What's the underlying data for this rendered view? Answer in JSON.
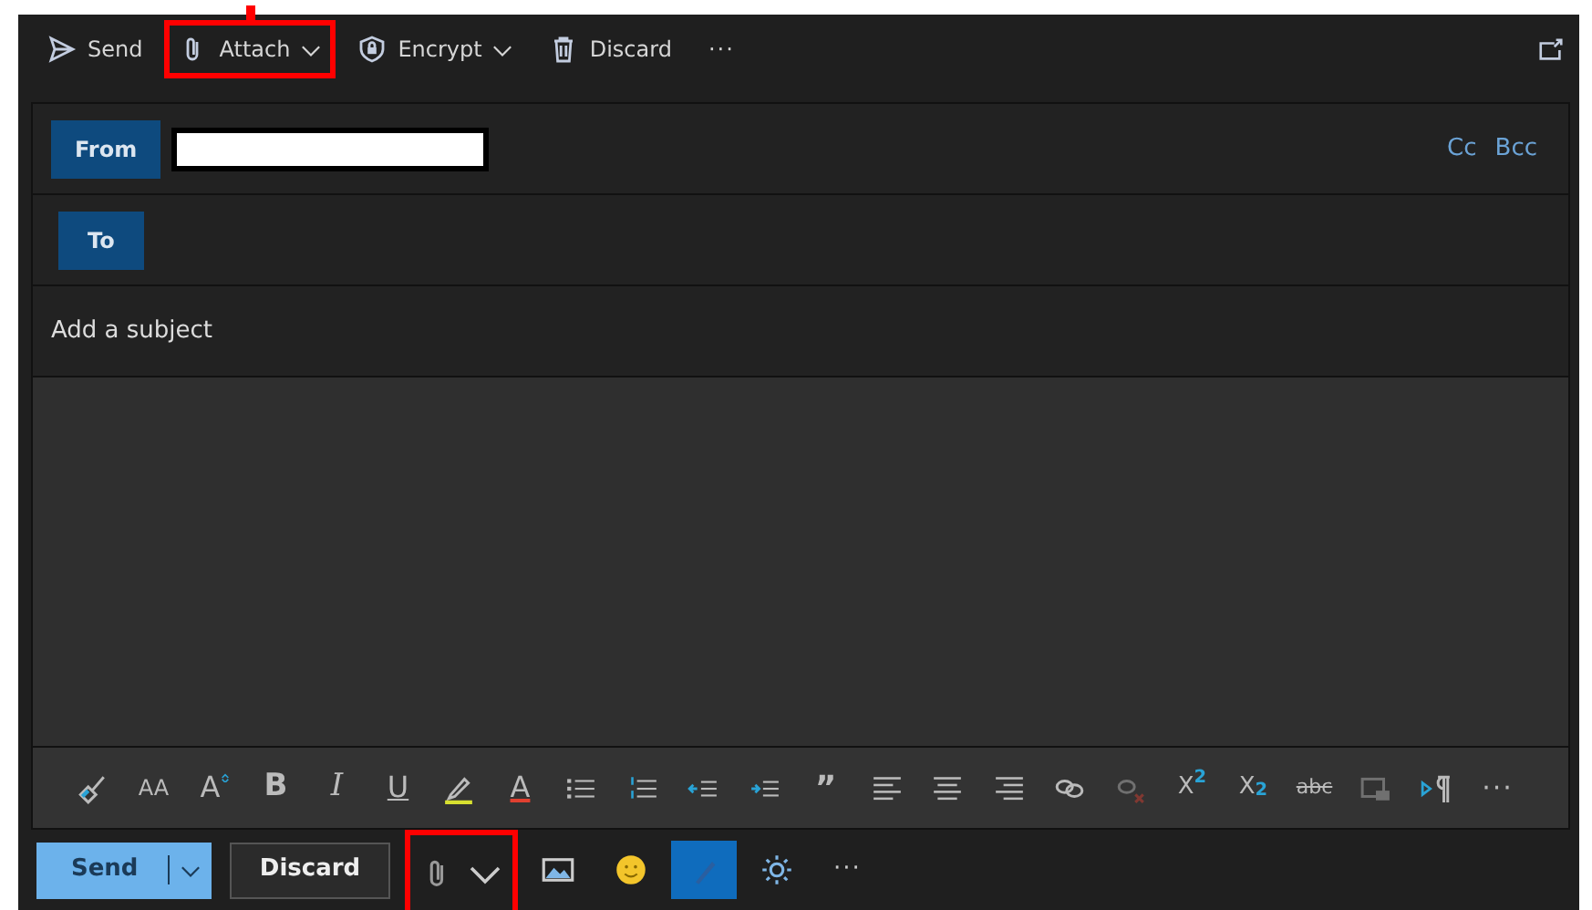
{
  "toolbar": {
    "items": [
      {
        "kind": "send",
        "label": "Send",
        "dropdown": false,
        "highlighted": false
      },
      {
        "kind": "attach",
        "label": "Attach",
        "dropdown": true,
        "highlighted": true
      },
      {
        "kind": "encrypt",
        "label": "Encrypt",
        "dropdown": true,
        "highlighted": false
      },
      {
        "kind": "discard",
        "label": "Discard",
        "dropdown": false,
        "highlighted": false
      },
      {
        "kind": "more",
        "label": "···",
        "highlighted": false
      }
    ]
  },
  "header": {
    "from": {
      "label": "From"
    },
    "to": {
      "label": "To"
    },
    "cc": "Cc",
    "bcc": "Bcc",
    "subject": {
      "placeholder": "Add a subject"
    }
  },
  "format_tools": [
    {
      "kind": "brush",
      "disabled": false
    },
    {
      "kind": "fontsize",
      "label": "AA",
      "disabled": false
    },
    {
      "kind": "grow",
      "label": "A",
      "disabled": false
    },
    {
      "kind": "bold",
      "label": "B",
      "disabled": false
    },
    {
      "kind": "italic",
      "label": "I",
      "disabled": false
    },
    {
      "kind": "underline",
      "label": "U",
      "disabled": false
    },
    {
      "kind": "highlight",
      "disabled": false
    },
    {
      "kind": "fontcolor",
      "label": "A",
      "disabled": false
    },
    {
      "kind": "bullets",
      "disabled": false
    },
    {
      "kind": "numbering",
      "disabled": false
    },
    {
      "kind": "outdent",
      "disabled": false
    },
    {
      "kind": "indent",
      "disabled": false
    },
    {
      "kind": "quote",
      "label": "”",
      "disabled": false
    },
    {
      "kind": "align-left",
      "disabled": false
    },
    {
      "kind": "align-center",
      "disabled": false
    },
    {
      "kind": "align-right",
      "disabled": false
    },
    {
      "kind": "link",
      "disabled": false
    },
    {
      "kind": "unlink",
      "disabled": true
    },
    {
      "kind": "text",
      "label": "X$^{2}$",
      "disabled": false
    },
    {
      "kind": "text",
      "label": "X$_{2}$",
      "disabled": false
    },
    {
      "kind": "strike",
      "label": "abc",
      "disabled": false
    },
    {
      "kind": "picture",
      "disabled": true
    },
    {
      "kind": "ltr",
      "disabled": false
    },
    {
      "kind": "more",
      "label": "···",
      "disabled": false
    }
  ],
  "actions": {
    "send": "Send",
    "discard": "Discard"
  },
  "bottom_tools": [
    {
      "kind": "attach",
      "dropdown": true,
      "highlighted": true,
      "selected": false
    },
    {
      "kind": "image",
      "dropdown": false,
      "highlighted": false,
      "selected": false
    },
    {
      "kind": "emoji",
      "dropdown": false,
      "highlighted": false,
      "selected": false
    },
    {
      "kind": "draw",
      "dropdown": false,
      "highlighted": false,
      "selected": true
    },
    {
      "kind": "brightness",
      "dropdown": false,
      "highlighted": false,
      "selected": false
    },
    {
      "kind": "more",
      "label": "···",
      "highlighted": false,
      "selected": false
    }
  ]
}
